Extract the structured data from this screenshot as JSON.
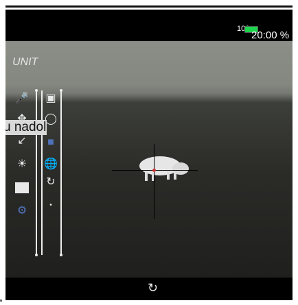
{
  "status": {
    "battery_level_text": "100",
    "battery_percent_text": "20:00 %",
    "battery_icon": "battery-icon"
  },
  "menu": {
    "title": "UNIT",
    "overlay_text": "u nadol",
    "icons_left": [
      "microphone-icon",
      "move-icon",
      "distance-icon",
      "brightness-icon",
      "display-icon",
      "settings-gear-icon"
    ],
    "icons_right": [
      "sd-card-icon",
      "circle-icon",
      "globe-icon",
      "refresh-icon",
      "info-dot-icon"
    ]
  },
  "viewfinder": {
    "crosshair": "crosshair-icon",
    "target": "wild-boar"
  },
  "bottom": {
    "shutter_icon": "camera-rotate-icon"
  },
  "colors": {
    "battery_green": "#1bd64c",
    "accent_blue": "#4f72b8",
    "reticle_red": "#cc3333"
  }
}
